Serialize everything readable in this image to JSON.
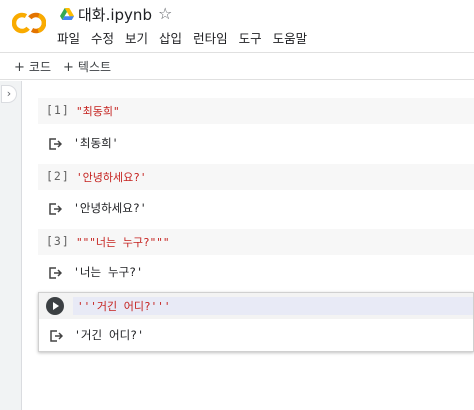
{
  "header": {
    "title": "대화.ipynb",
    "star_glyph": "☆",
    "menu": [
      "파일",
      "수정",
      "보기",
      "삽입",
      "런타임",
      "도구",
      "도움말"
    ]
  },
  "toolbar": {
    "add_code": "코드",
    "add_text": "텍스트",
    "plus_glyph": "+"
  },
  "sidebar": {
    "collapse_glyph": "›"
  },
  "cells": [
    {
      "prompt": "[1]",
      "code": "\"최동희\"",
      "output": "'최동희'"
    },
    {
      "prompt": "[2]",
      "code": "'안녕하세요?'",
      "output": "'안녕하세요?'"
    },
    {
      "prompt": "[3]",
      "code": "\"\"\"너는 누구?\"\"\"",
      "output": "'너는 누구?'"
    },
    {
      "prompt": "",
      "code": "'''거긴 어디?'''",
      "output": "'거긴 어디?'"
    }
  ],
  "colors": {
    "logo_orange": "#F9AB00",
    "logo_dark": "#E37400",
    "string_red": "#c5221f",
    "cell_bg": "#f7f7f7"
  }
}
